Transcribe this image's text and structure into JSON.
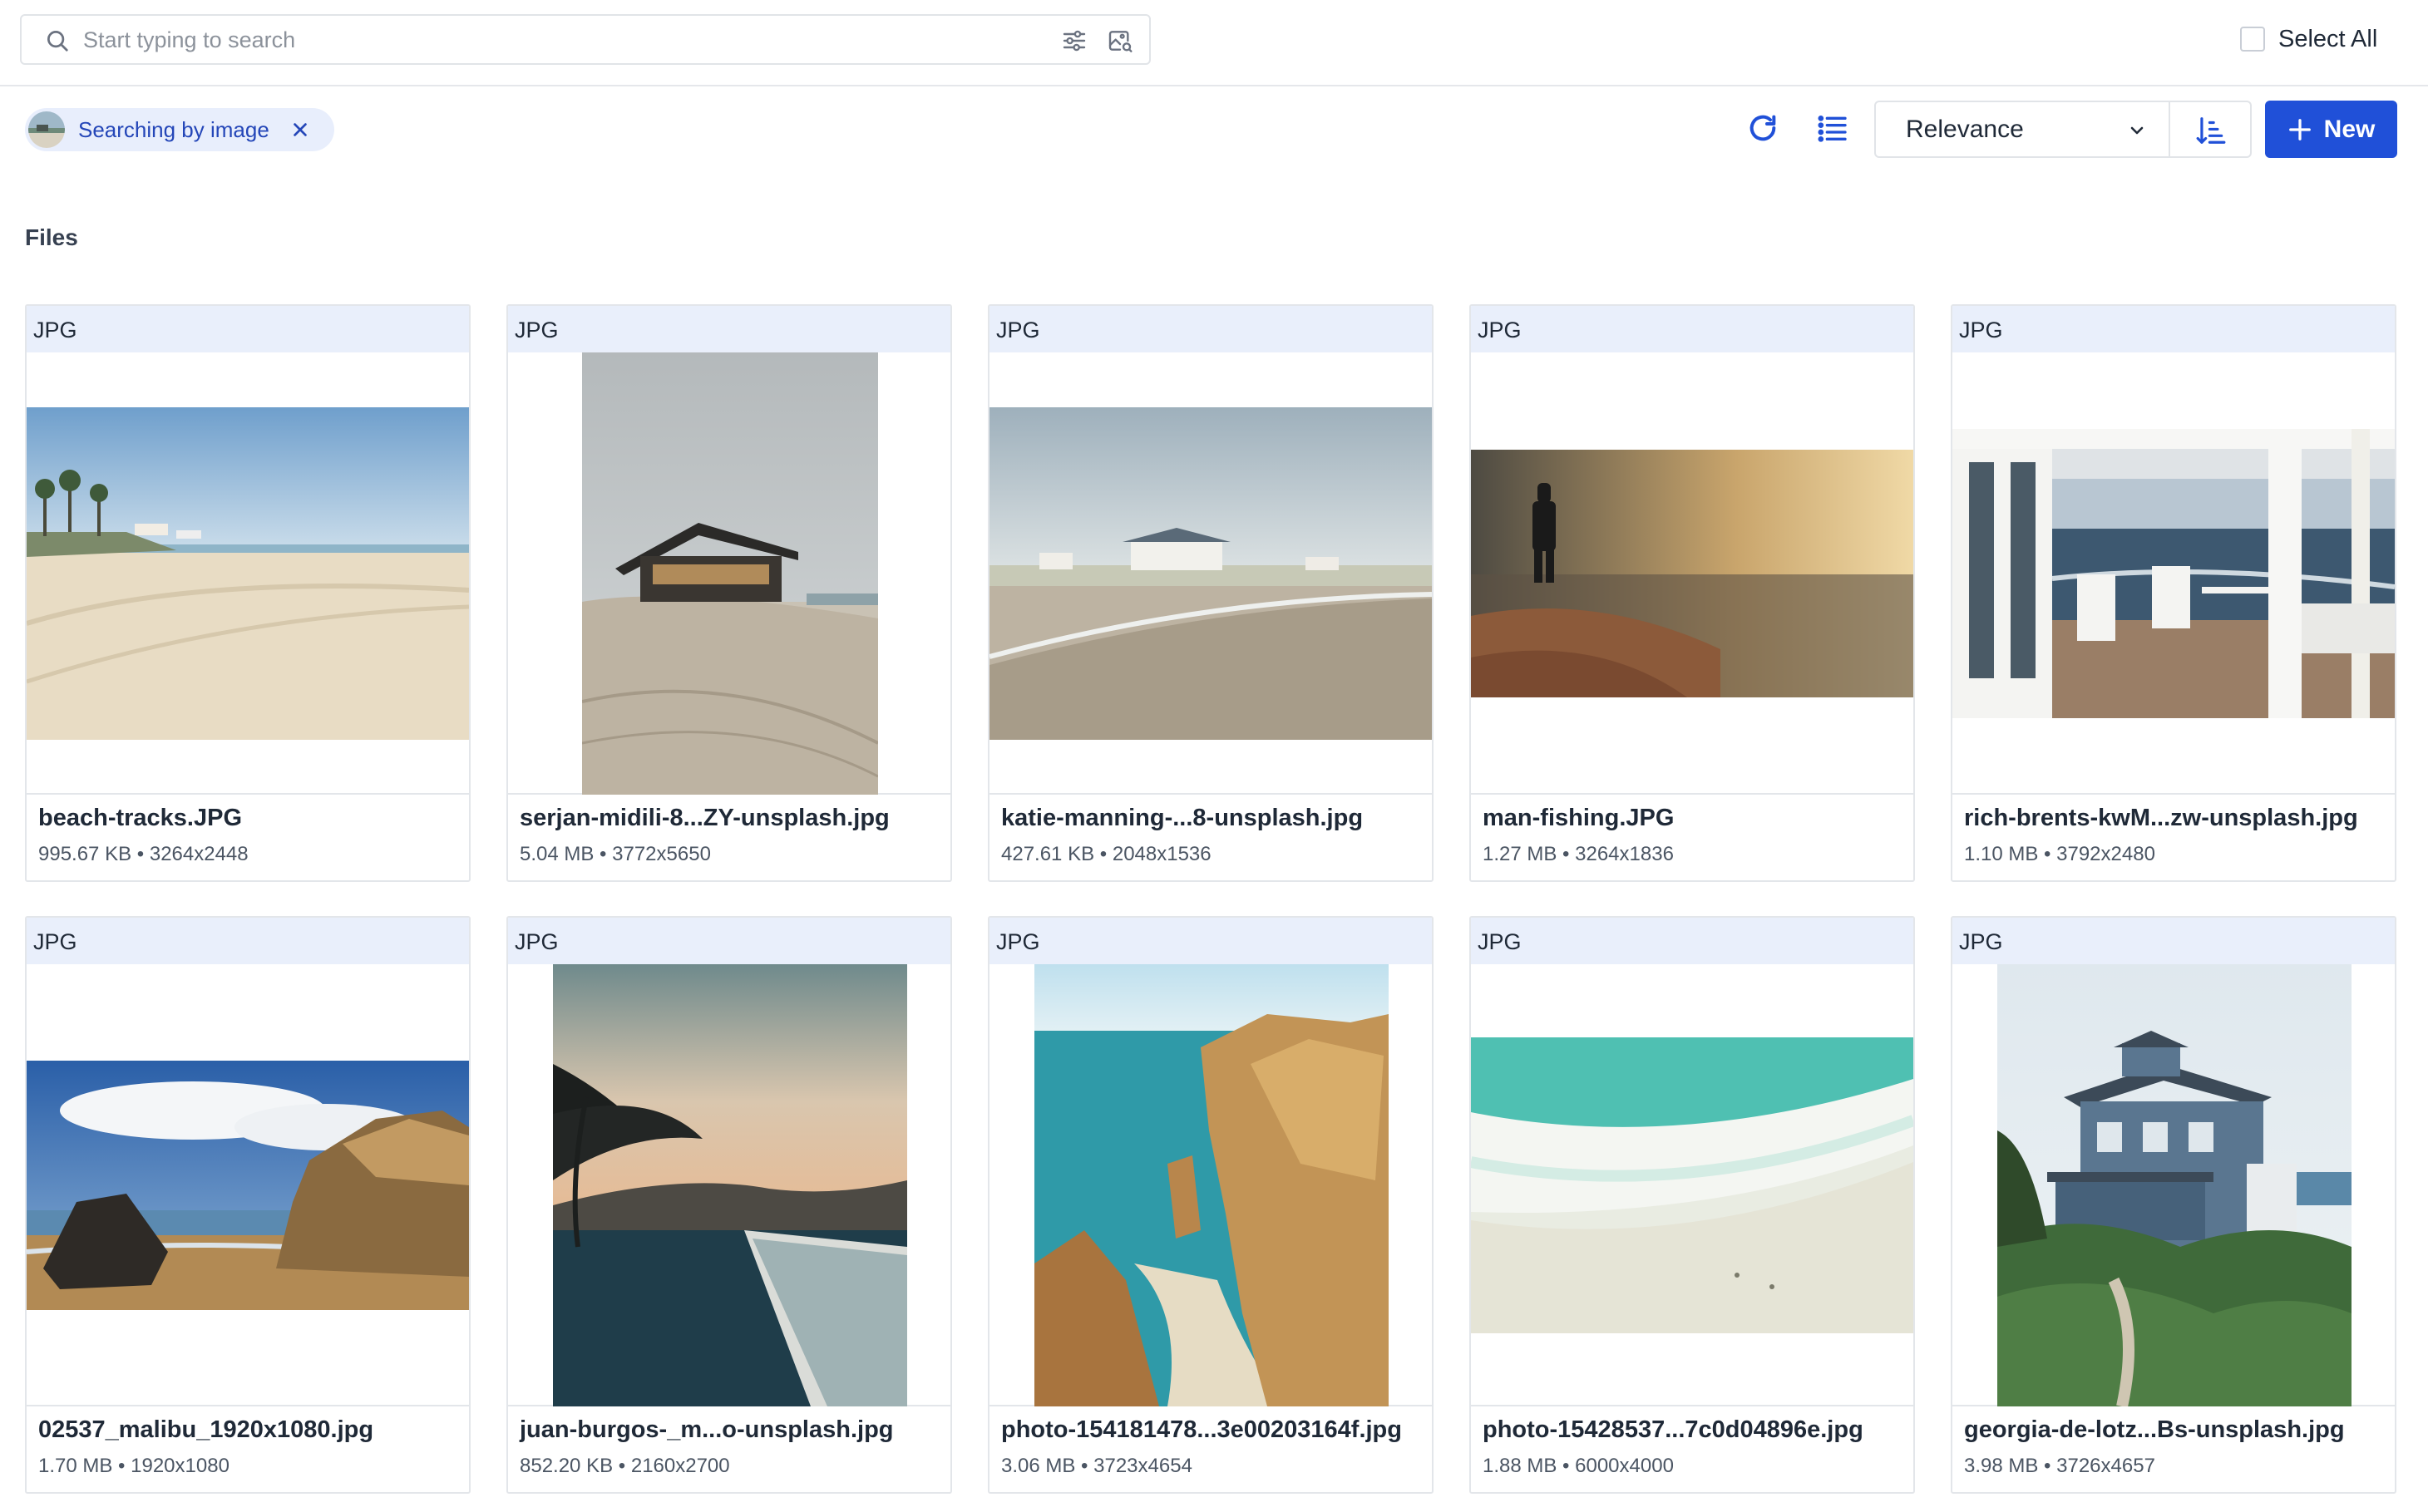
{
  "search": {
    "placeholder": "Start typing to search",
    "value": ""
  },
  "select_all_label": "Select All",
  "chip": {
    "label": "Searching by image"
  },
  "sort": {
    "selected": "Relevance"
  },
  "new_button": "New",
  "section_title": "Files",
  "colors": {
    "accent": "#2050d8",
    "chip_bg": "#e8eefc",
    "type_bar": "#e9effb"
  },
  "files": [
    {
      "type": "JPG",
      "name": "beach-tracks.JPG",
      "size": "995.67 KB",
      "dims": "3264x2448"
    },
    {
      "type": "JPG",
      "name": "serjan-midili-8...ZY-unsplash.jpg",
      "size": "5.04 MB",
      "dims": "3772x5650"
    },
    {
      "type": "JPG",
      "name": "katie-manning-...8-unsplash.jpg",
      "size": "427.61 KB",
      "dims": "2048x1536"
    },
    {
      "type": "JPG",
      "name": "man-fishing.JPG",
      "size": "1.27 MB",
      "dims": "3264x1836"
    },
    {
      "type": "JPG",
      "name": "rich-brents-kwM...zw-unsplash.jpg",
      "size": "1.10 MB",
      "dims": "3792x2480"
    },
    {
      "type": "JPG",
      "name": "02537_malibu_1920x1080.jpg",
      "size": "1.70 MB",
      "dims": "1920x1080"
    },
    {
      "type": "JPG",
      "name": "juan-burgos-_m...o-unsplash.jpg",
      "size": "852.20 KB",
      "dims": "2160x2700"
    },
    {
      "type": "JPG",
      "name": "photo-154181478...3e00203164f.jpg",
      "size": "3.06 MB",
      "dims": "3723x4654"
    },
    {
      "type": "JPG",
      "name": "photo-15428537...7c0d04896e.jpg",
      "size": "1.88 MB",
      "dims": "6000x4000"
    },
    {
      "type": "JPG",
      "name": "georgia-de-lotz...Bs-unsplash.jpg",
      "size": "3.98 MB",
      "dims": "3726x4657"
    }
  ]
}
